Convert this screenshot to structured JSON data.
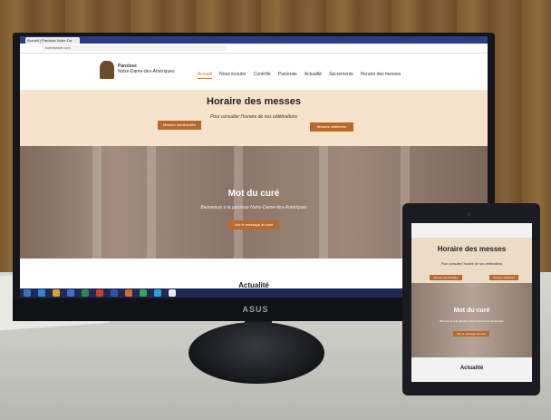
{
  "monitor": {
    "brand": "ASUS",
    "browser": {
      "tab_title": "Accueil | Paroisse Notre-Da",
      "url": "notredame.com"
    },
    "site": {
      "name_line1": "Paroisse",
      "name_line2": "Notre-Dame-des-Amériques",
      "nav": [
        "Accueil",
        "Nous écouter",
        "Contrôle",
        "Pastorale",
        "Actualité",
        "Sacrements",
        "Horaire des messes"
      ],
      "section_masses": {
        "title": "Horaire des messes",
        "subtitle": "Pour consulter l'horaire de nos célébrations",
        "button_left": "Messes dominicales",
        "button_right": "Messes célébrées"
      },
      "section_cure": {
        "title": "Mot du curé",
        "subtitle": "Bienvenue à la paroisse Notre-Dame-des-Amériques",
        "button": "Voir le message du curé"
      },
      "section_news": {
        "title": "Actualité"
      }
    }
  },
  "tablet": {
    "masses_title": "Horaire des messes",
    "masses_subtitle": "Pour consulter l'horaire de nos célébrations",
    "button_left": "Messes dominicales",
    "button_right": "Messes célébrées",
    "cure_title": "Mot du curé",
    "cure_subtitle": "Bienvenue à la paroisse Notre-Dame-des-Amériques",
    "cure_button": "Voir le message du curé",
    "news_title": "Actualité"
  },
  "colors": {
    "accent": "#b86a2c",
    "masses_bg": "#f7e2cc",
    "taskbar": "#1e2a55"
  }
}
